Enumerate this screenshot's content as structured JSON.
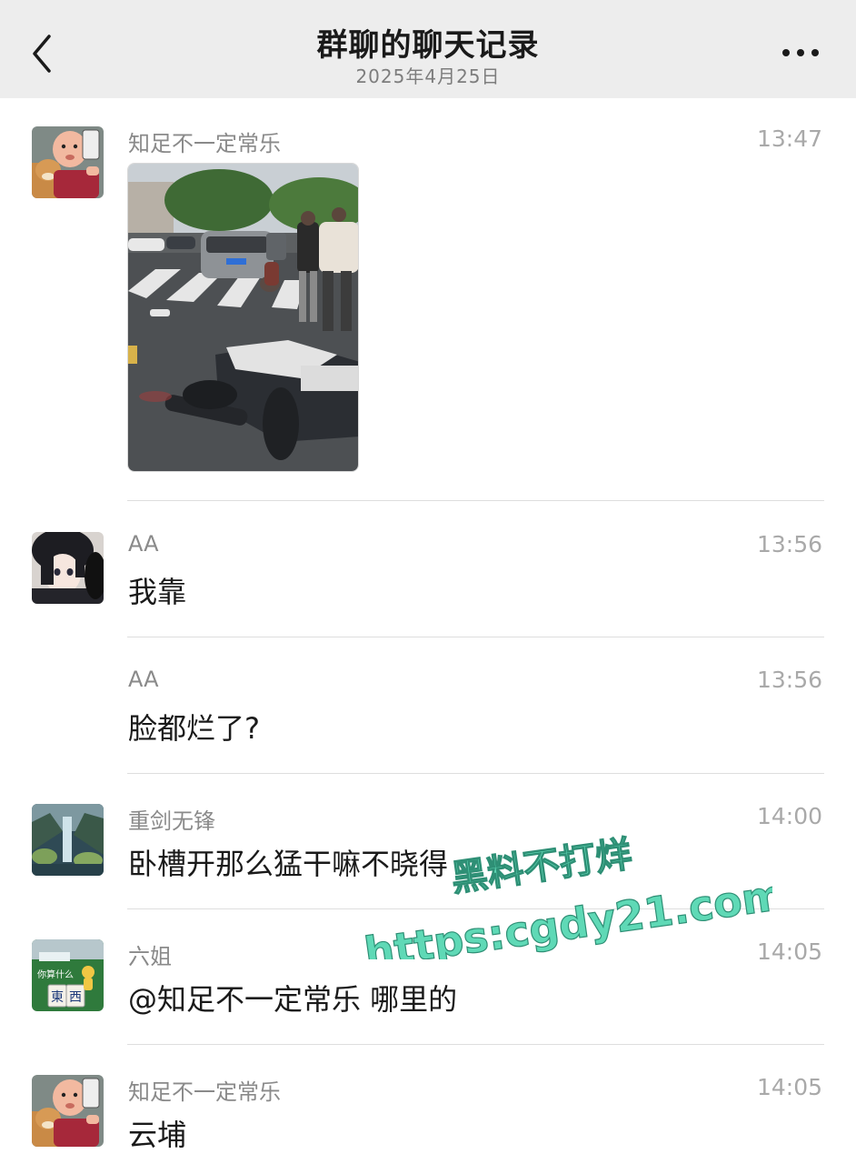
{
  "header": {
    "title": "群聊的聊天记录",
    "date": "2025年4月25日",
    "back_icon": "chevron-left-icon",
    "more_icon": "more-dots-icon"
  },
  "messages": [
    {
      "sender": "知足不一定常乐",
      "time": "13:47",
      "type": "image",
      "avatar": "baby-selfie-avatar"
    },
    {
      "sender": "AA",
      "time": "13:56",
      "text": "我靠",
      "avatar": "anime-couple-avatar"
    },
    {
      "sender": "AA",
      "time": "13:56",
      "text": "脸都烂了?"
    },
    {
      "sender": "重剑无锋",
      "time": "14:00",
      "text": "卧槽开那么猛干嘛不晓得",
      "avatar": "waterfall-landscape-avatar"
    },
    {
      "sender": "六姐",
      "time": "14:05",
      "text": "@知足不一定常乐 哪里的",
      "avatar": "mahjong-tile-avatar"
    },
    {
      "sender": "知足不一定常乐",
      "time": "14:05",
      "text": "云埔",
      "avatar": "baby-selfie-avatar"
    }
  ],
  "watermark": {
    "line1": "黑料不打烊",
    "line2": "https:cgdy21.com",
    "color": "#5fd9b6"
  },
  "avatar_texts": {
    "mahjong_top": "你算什么",
    "mahjong_tile1": "東",
    "mahjong_tile2": "西"
  },
  "colors": {
    "header_bg": "#ededed",
    "sender": "#8a8a8a",
    "time": "#a9a9a9",
    "divider": "#dedede"
  }
}
